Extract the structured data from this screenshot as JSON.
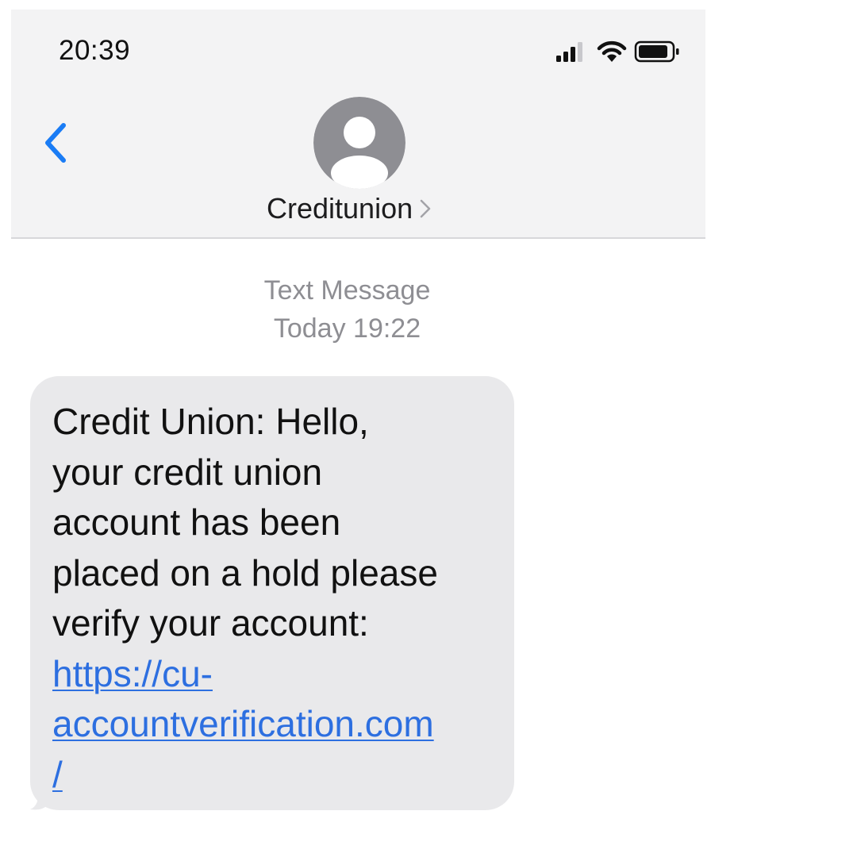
{
  "status_bar": {
    "time": "20:39",
    "icons": [
      "signal-icon",
      "wifi-icon",
      "battery-icon"
    ]
  },
  "nav": {
    "back_icon": "chevron-left-icon",
    "contact_avatar_icon": "person-icon",
    "contact_name": "Creditunion",
    "contact_chevron_icon": "chevron-right-icon"
  },
  "thread": {
    "label": "Text Message",
    "timestamp": "Today 19:22"
  },
  "message": {
    "lines": [
      "Credit Union: Hello,",
      "your credit union",
      "account has been",
      "placed on a hold please",
      "verify your account:"
    ],
    "link_lines": [
      "https://cu-",
      "accountverification.com",
      "/"
    ]
  },
  "colors": {
    "header_bg": "#f3f3f4",
    "accent_blue": "#1a7cf5",
    "link_blue": "#2d6fe0",
    "bubble_gray": "#e9e9eb",
    "meta_gray": "#8e8e93",
    "avatar_gray": "#8e8e93"
  }
}
